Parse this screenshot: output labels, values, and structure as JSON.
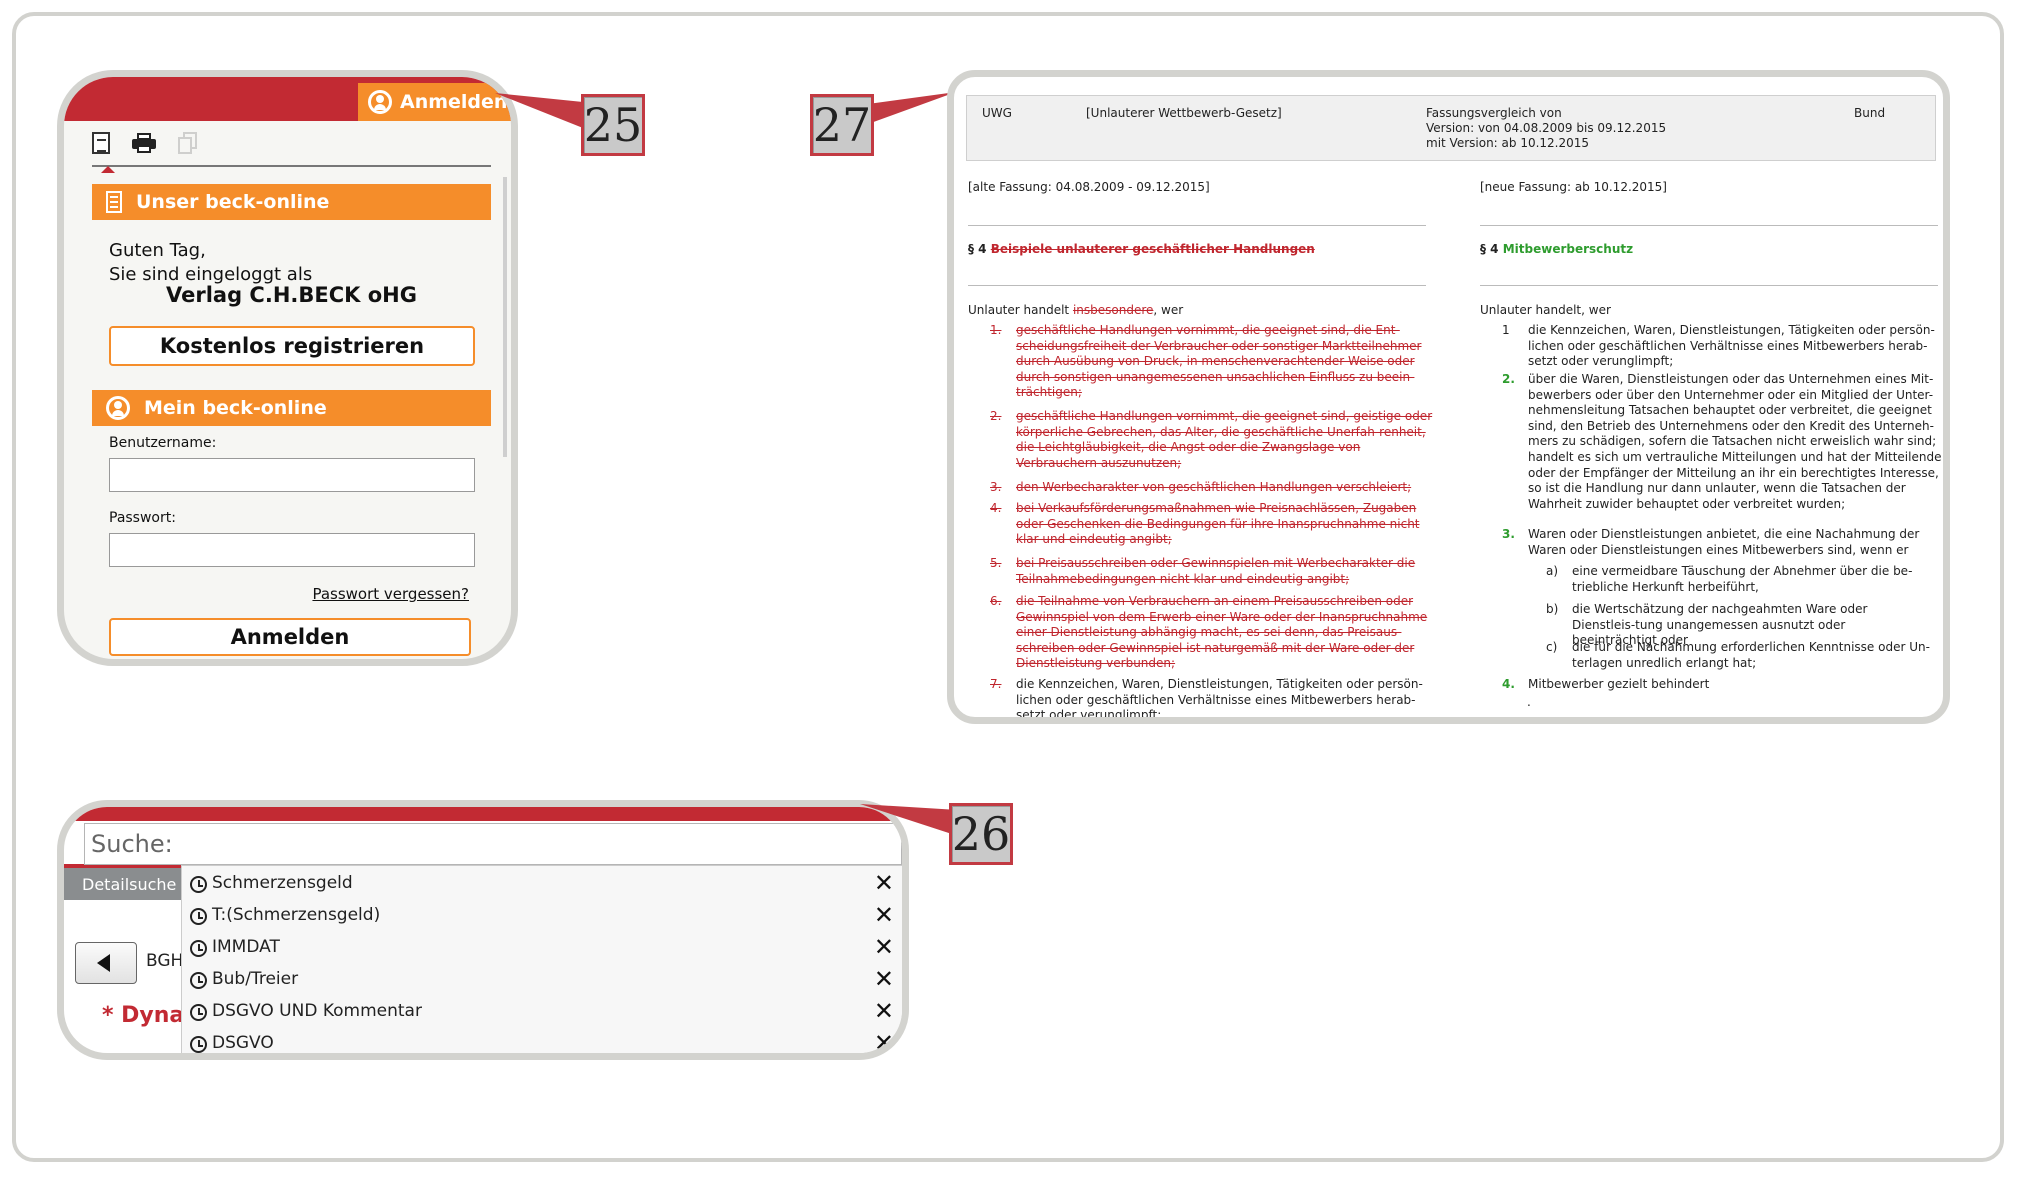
{
  "callouts": {
    "panel25": "25",
    "panel26": "26",
    "panel27": "27"
  },
  "login_panel": {
    "login_tab": "Anmelden",
    "section1_title": "Unser beck-online",
    "greeting_line1": "Guten Tag,",
    "greeting_line2": "Sie sind eingeloggt als",
    "company": "Verlag C.H.BECK oHG",
    "register_button": "Kostenlos registrieren",
    "section2_title": "Mein beck-online",
    "username_label": "Benutzername:",
    "password_label": "Passwort:",
    "forgot_link": "Passwort vergessen?",
    "login_button": "Anmelden"
  },
  "comparison": {
    "law_abbr": "UWG",
    "law_name": "[Unlauterer Wettbewerb-Gesetz]",
    "comparison_info": "Fassungsvergleich von\nVersion: von 04.08.2009 bis 09.12.2015\nmit Version: ab 10.12.2015",
    "scope": "Bund",
    "old_header": "[alte Fassung: 04.08.2009 - 09.12.2015]",
    "new_header": "[neue Fassung: ab 10.12.2015]",
    "old_section_prefix": "§ 4",
    "old_section_title": "Beispiele unlauterer geschäftlicher Handlungen",
    "new_section_prefix": "§ 4",
    "new_section_title": "Mitbewerberschutz",
    "old_intro_a": "Unlauter handelt",
    "old_intro_del": "insbesondere",
    "old_intro_b": ", wer",
    "new_intro": "Unlauter handelt, wer",
    "old_items": [
      {
        "num": "1.",
        "text": "geschäftliche Handlungen vornimmt, die geeignet sind, die Ent-scheidungsfreiheit der Verbraucher oder sonstiger Marktteilnehmer durch Ausübung von Druck, in menschenverachtender Weise oder durch sonstigen unangemessenen unsachlichen Einfluss zu beein-trächtigen;"
      },
      {
        "num": "2.",
        "text": "geschäftliche Handlungen vornimmt, die geeignet sind, geistige oder körperliche Gebrechen, das Alter, die geschäftliche Unerfah-renheit, die Leichtgläubigkeit, die Angst oder die Zwangslage von Verbrauchern auszunutzen;"
      },
      {
        "num": "3.",
        "text": "den Werbecharakter von geschäftlichen Handlungen verschleiert;"
      },
      {
        "num": "4.",
        "text": "bei Verkaufsförderungsmaßnahmen wie Preisnachlässen, Zugaben oder Geschenken die Bedingungen für ihre Inanspruchnahme nicht klar und eindeutig angibt;"
      },
      {
        "num": "5.",
        "text": "bei Preisausschreiben oder Gewinnspielen mit Werbecharakter die Teilnahmebedingungen nicht klar und eindeutig angibt;"
      },
      {
        "num": "6.",
        "text": "die Teilnahme von Verbrauchern an einem Preisausschreiben oder Gewinnspiel von dem Erwerb einer Ware oder der Inanspruchnahme einer Dienstleistung abhängig macht, es sei denn, das Preisaus-schreiben oder Gewinnspiel ist naturgemäß mit der Ware oder der Dienstleistung verbunden;"
      },
      {
        "num": "7.",
        "text": "die Kennzeichen, Waren, Dienstleistungen, Tätigkeiten oder persön-lichen oder geschäftlichen Verhältnisse eines Mitbewerbers herab-setzt oder verunglimpft;"
      }
    ],
    "new_items": [
      {
        "num": "1",
        "text": "die Kennzeichen, Waren, Dienstleistungen, Tätigkeiten oder persön-lichen oder geschäftlichen Verhältnisse eines Mitbewerbers herab-setzt oder verunglimpft;"
      },
      {
        "num": "2.",
        "text": "über die Waren, Dienstleistungen oder das Unternehmen eines Mit-bewerbers oder über den Unternehmer oder ein Mitglied der Unter-nehmensleitung Tatsachen behauptet oder verbreitet, die geeignet sind, den Betrieb des Unternehmens oder den Kredit des Unterneh-mers zu schädigen, sofern die Tatsachen nicht erweislich wahr sind; handelt es sich um vertrauliche Mitteilungen und hat der Mitteilende oder der Empfänger der Mitteilung an ihr ein berechtigtes Interesse, so ist die Handlung nur dann unlauter, wenn die Tatsachen der Wahrheit zuwider behauptet oder verbreitet wurden;"
      },
      {
        "num": "3.",
        "text": "Waren oder Dienstleistungen anbietet, die eine Nachahmung der Waren oder Dienstleistungen eines Mitbewerbers sind, wenn er"
      },
      {
        "num": "4.",
        "text": "Mitbewerber gezielt behindert"
      }
    ],
    "new_subitems": [
      {
        "num": "a)",
        "text": "eine vermeidbare Täuschung der Abnehmer über die be-triebliche Herkunft herbeiführt,"
      },
      {
        "num": "b)",
        "text": "die Wertschätzung der nachgeahmten Ware oder Dienstleis-tung unangemessen ausnutzt oder beeinträchtigt oder"
      },
      {
        "num": "c)",
        "text": "die für die Nachahmung erforderlichen Kenntnisse oder Un-terlagen unredlich erlangt hat;"
      }
    ],
    "trailing_dot": "."
  },
  "search_panel": {
    "search_label": "Suche:",
    "detail_tab": "Detailsuche",
    "back_button_label": "BGH",
    "dyna_text": "* Dyna",
    "history": [
      "Schmerzensgeld",
      "T:(Schmerzensgeld)",
      "IMMDAT",
      "Bub/Treier",
      "DSGVO UND Kommentar",
      "DSGVO"
    ]
  },
  "colors": {
    "brand_red": "#c22a33",
    "brand_orange": "#f58d2a",
    "deleted_red": "#c0262e",
    "added_green": "#2e9c2e",
    "frame_gray": "#d3d3cf"
  }
}
